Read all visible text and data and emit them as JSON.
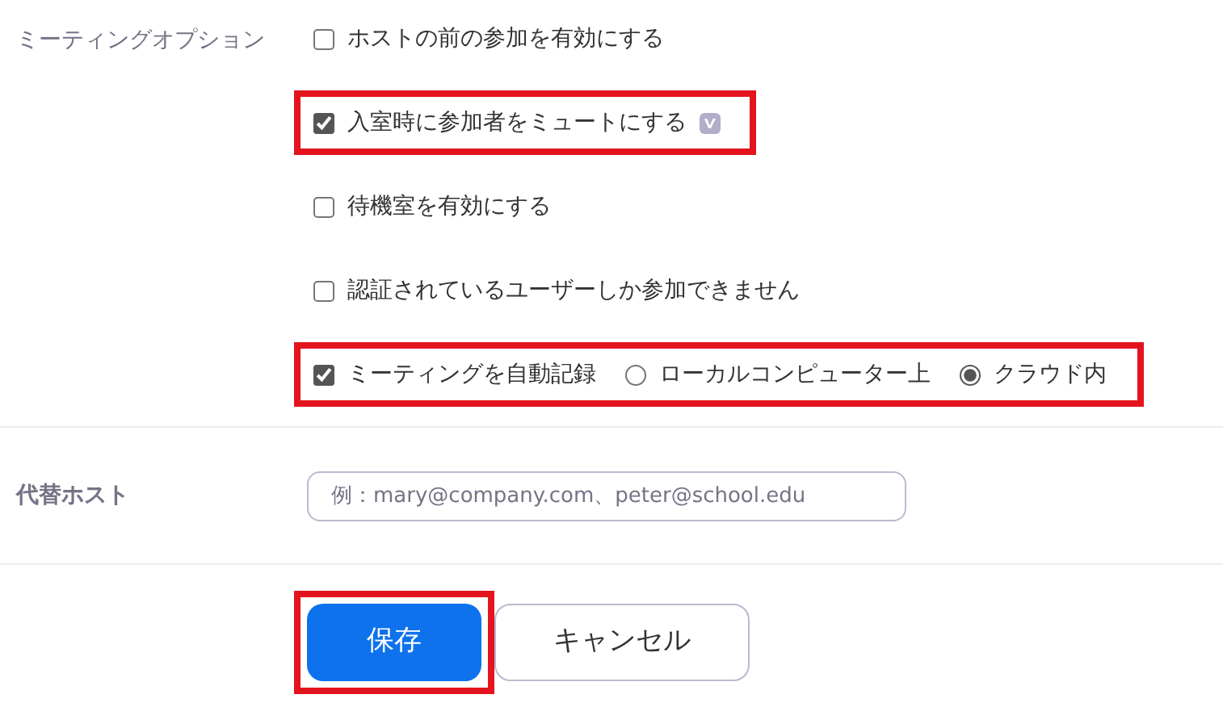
{
  "meeting_options": {
    "label": "ミーティングオプション",
    "options": [
      {
        "kind": "checkbox",
        "label": "ホストの前の参加を有効にする",
        "checked": false,
        "highlighted": false
      },
      {
        "kind": "checkbox",
        "label": "入室時に参加者をミュートにする",
        "checked": true,
        "highlighted": true,
        "info_badge": true
      },
      {
        "kind": "checkbox",
        "label": "待機室を有効にする",
        "checked": false,
        "highlighted": false
      },
      {
        "kind": "checkbox",
        "label": "認証されているユーザーしか参加できません",
        "checked": false,
        "highlighted": false
      },
      {
        "kind": "checkbox_radios",
        "label": "ミーティングを自動記録",
        "checked": true,
        "highlighted": true,
        "radios": [
          {
            "label": "ローカルコンピューター上",
            "selected": false
          },
          {
            "label": "クラウド内",
            "selected": true
          }
        ]
      }
    ]
  },
  "alternative_host": {
    "label": "代替ホスト",
    "placeholder": "例：mary@company.com、peter@school.edu"
  },
  "buttons": [
    {
      "kind": "primary",
      "label": "保存",
      "highlighted": true
    },
    {
      "kind": "secondary",
      "label": "キャンセル",
      "highlighted": false
    }
  ]
}
